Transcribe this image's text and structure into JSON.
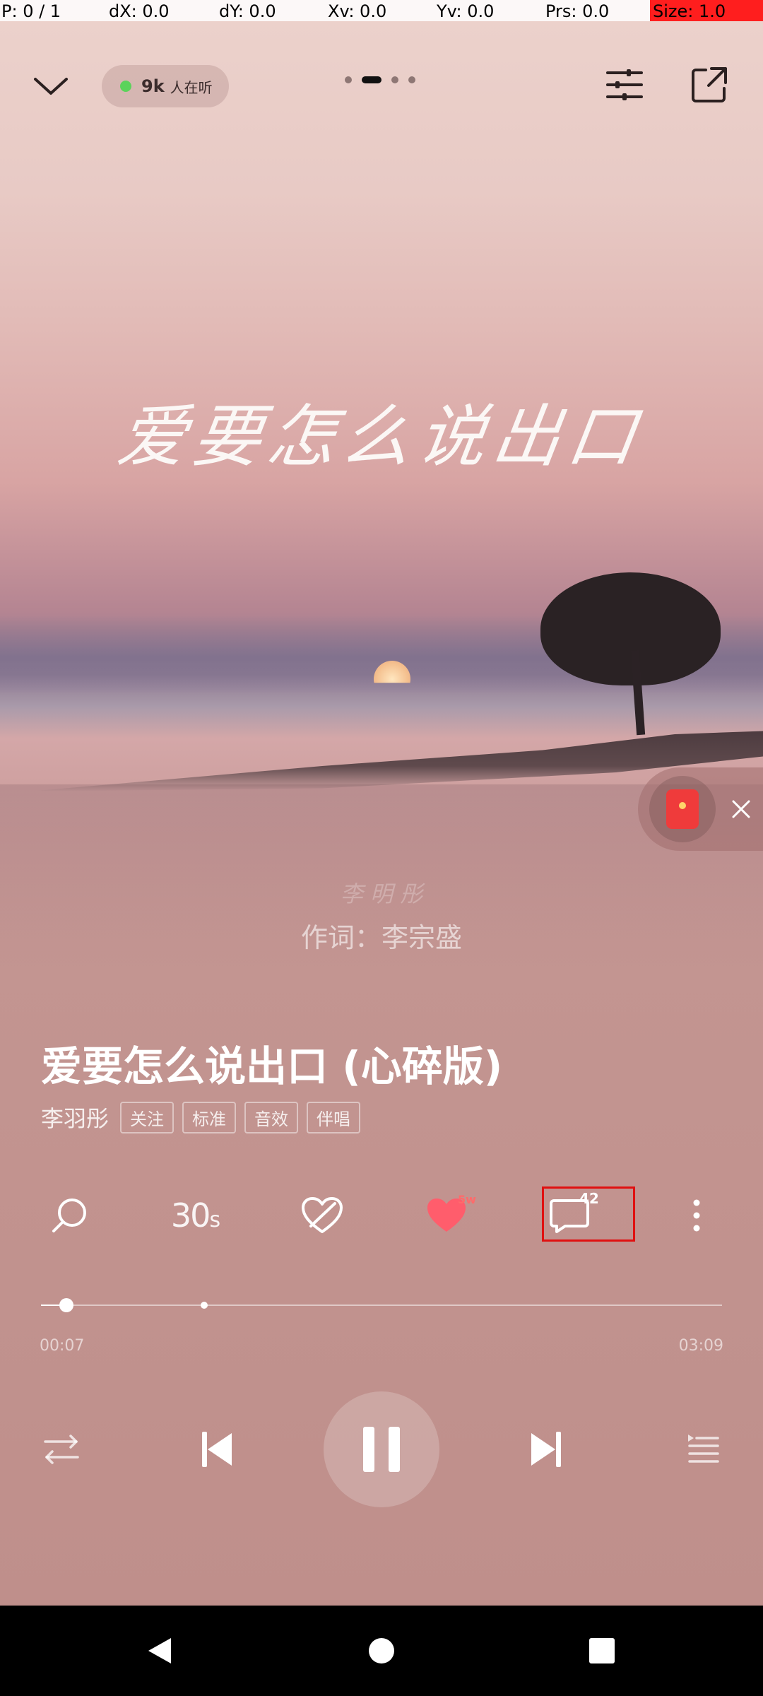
{
  "debug": {
    "pointer": "P: 0 / 1",
    "dx": "dX: 0.0",
    "dy": "dY: 0.0",
    "xv": "Xv: 0.0",
    "yv": "Yv: 0.0",
    "prs": "Prs: 0.0",
    "size": "Size: 1.0"
  },
  "header": {
    "listeners_count": "9k",
    "listeners_text": "人在听",
    "page_indicator": {
      "total": 4,
      "active": 1
    }
  },
  "cover": {
    "title_art": "爱要怎么说出口",
    "lyric_ghost": "李 明 彤",
    "lyric_line": "作词：李宗盛"
  },
  "song": {
    "title": "爱要怎么说出口 (心碎版)",
    "artist": "李羽彤",
    "tags": [
      "关注",
      "标准",
      "音效",
      "伴唱"
    ]
  },
  "actions": {
    "clip_label": "30",
    "clip_unit": "s",
    "like_badge": "5w",
    "comment_count": "42"
  },
  "progress": {
    "current": "00:07",
    "total": "03:09",
    "fraction": 0.037,
    "buffered_fraction": 0.24
  },
  "colors": {
    "like": "#ff5d6c",
    "highlight_box": "#e01010",
    "listen_dot": "#5bd35b"
  },
  "icons": {
    "collapse": "chevron-down-icon",
    "equalizer": "sliders-icon",
    "share": "share-icon",
    "search": "search-icon",
    "dislike": "broken-heart-icon",
    "like": "heart-icon",
    "comment": "comment-icon",
    "more": "more-vertical-icon",
    "repeat": "repeat-icon",
    "prev": "skip-prev-icon",
    "pause": "pause-icon",
    "next": "skip-next-icon",
    "playlist": "playlist-icon"
  }
}
